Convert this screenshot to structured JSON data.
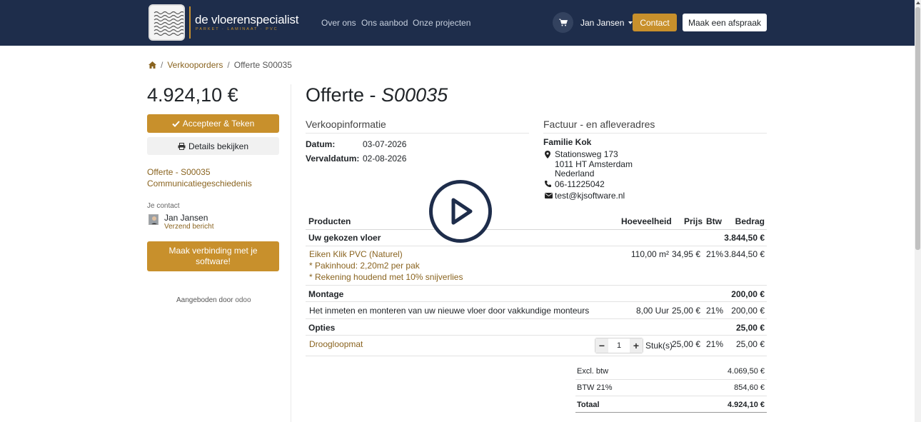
{
  "brand": {
    "name": "de vloerenspecialist",
    "tagline": "PARKET · LAMINAAT · PVC"
  },
  "nav": {
    "links": [
      "Over ons",
      "Ons aanbod",
      "Onze projecten"
    ],
    "user": "Jan Jansen",
    "contact_label": "Contact",
    "appointment_label": "Maak een afspraak"
  },
  "breadcrumb": {
    "orders": "Verkooporders",
    "current": "Offerte S00035"
  },
  "sidebar": {
    "amount": "4.924,10 €",
    "accept_label": "Accepteer & Teken",
    "details_label": "Details bekijken",
    "link_quote": "Offerte - S00035",
    "link_history": "Communicatiegeschiedenis",
    "contact_heading": "Je contact",
    "contact_name": "Jan Jansen",
    "contact_send": "Verzend bericht",
    "connect_label": "Maak verbinding met je software!",
    "powered_by": "Aangeboden door",
    "powered_brand": "odoo"
  },
  "quote": {
    "title_prefix": "Offerte - ",
    "title_number": "S00035",
    "sales_info_heading": "Verkoopinformatie",
    "date_label": "Datum:",
    "date_value": "03-07-2026",
    "due_label": "Vervaldatum:",
    "due_value": "02-08-2026",
    "address_heading": "Factuur - en afleveradres",
    "customer": "Familie Kok",
    "street": "Stationsweg 173",
    "city": "1011 HT Amsterdam",
    "country": "Nederland",
    "phone": "06-11225042",
    "email": "test@kjsoftware.nl"
  },
  "table": {
    "headers": {
      "product": "Producten",
      "qty": "Hoeveelheid",
      "price": "Prijs",
      "vat": "Btw",
      "amount": "Bedrag"
    },
    "section1": {
      "name": "Uw gekozen vloer",
      "total": "3.844,50 €"
    },
    "item1": {
      "name": "Eiken Klik PVC (Naturel)",
      "note1": "* Pakinhoud: 2,20m2 per pak",
      "note2": "* Rekening houdend met 10% snijverlies",
      "qty": "110,00 m²",
      "price": "34,95 €",
      "vat": "21%",
      "amount": "3.844,50 €"
    },
    "section2": {
      "name": "Montage",
      "total": "200,00 €"
    },
    "item2": {
      "name": "Het inmeten en monteren van uw nieuwe vloer door vakkundige monteurs",
      "qty": "8,00 Uur",
      "price": "25,00 €",
      "vat": "21%",
      "amount": "200,00 €"
    },
    "section3": {
      "name": "Opties",
      "total": "25,00 €"
    },
    "item3": {
      "name": "Droogloopmat",
      "qty_value": "1",
      "unit": "Stuk(s)",
      "price": "25,00 €",
      "vat": "21%",
      "amount": "25,00 €"
    }
  },
  "totals": {
    "excl_label": "Excl. btw",
    "excl_value": "4.069,50 €",
    "vat_label": "BTW 21%",
    "vat_value": "854,60 €",
    "total_label": "Totaal",
    "total_value": "4.924,10 €"
  },
  "colors": {
    "navbar": "#1e2d4b",
    "accent": "#c8902c",
    "link": "#8a6420"
  }
}
